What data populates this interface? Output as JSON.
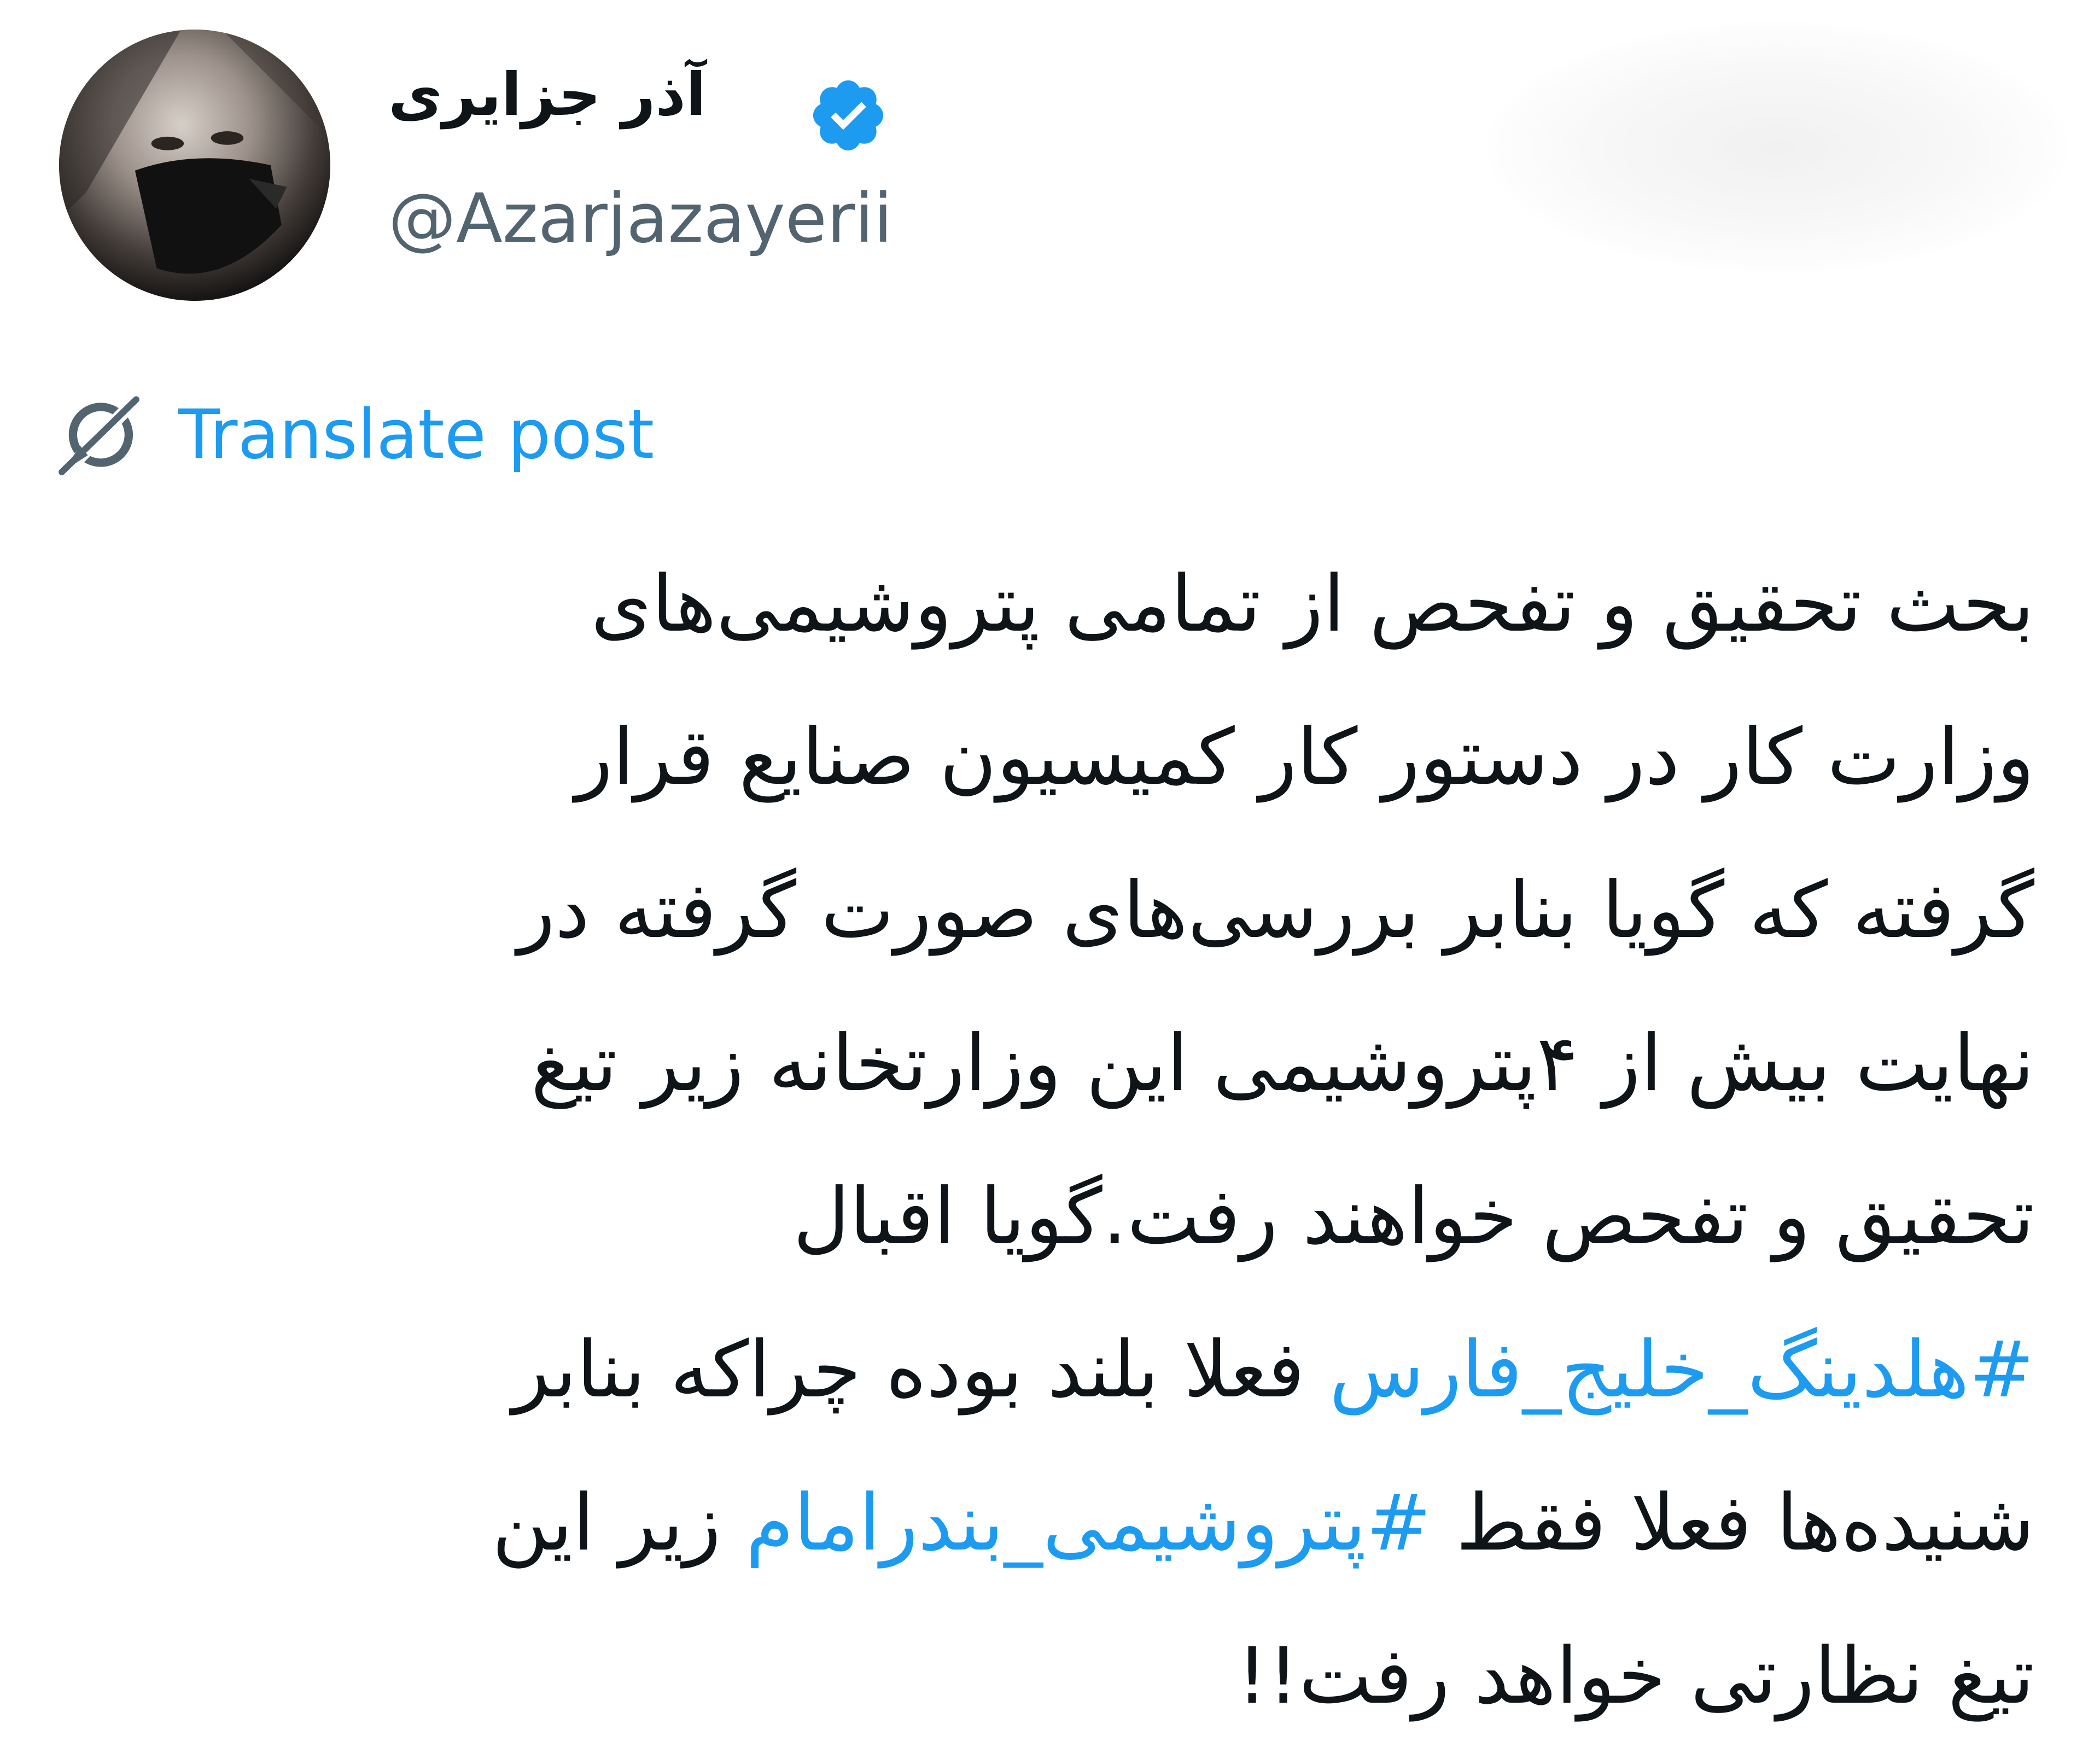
{
  "author": {
    "display_name": "آذر جزایری",
    "handle": "@Azarjazayerii",
    "verified": true,
    "avatar_icon": "avatar-photo",
    "verified_icon": "verified-badge-icon"
  },
  "translate": {
    "label": "Translate post",
    "icon": "translate-globe-icon"
  },
  "post": {
    "lines": [
      "بحث تحقیق و تفحص از تمامی پتروشیمی‌های",
      "وزارت کار در  دستور کار کمیسیون صنایع قرار",
      "گرفته که گویا بنابر بررسی‌های صورت گرفته در",
      "نهایت بیش از ۴پتروشیمی این وزارتخانه زیر تیغ",
      "تحقیق و تفحص خواهند رفت.گویا اقبال"
    ],
    "line6_hashtag": "#هلدینگ_خلیج_فارس",
    "line6_text": " فعلا بلند بوده چراکه بنابر",
    "line7_text_before": "شنیده‌ها فعلا فقط ",
    "line7_hashtag": "#پتروشیمی_بندرامام",
    "line7_text_after": " زیر این",
    "line8": "تیغ نظارتی خواهد رفت!!"
  },
  "colors": {
    "text": "#0f1419",
    "secondary": "#536471",
    "accent": "#1d9bf0"
  }
}
